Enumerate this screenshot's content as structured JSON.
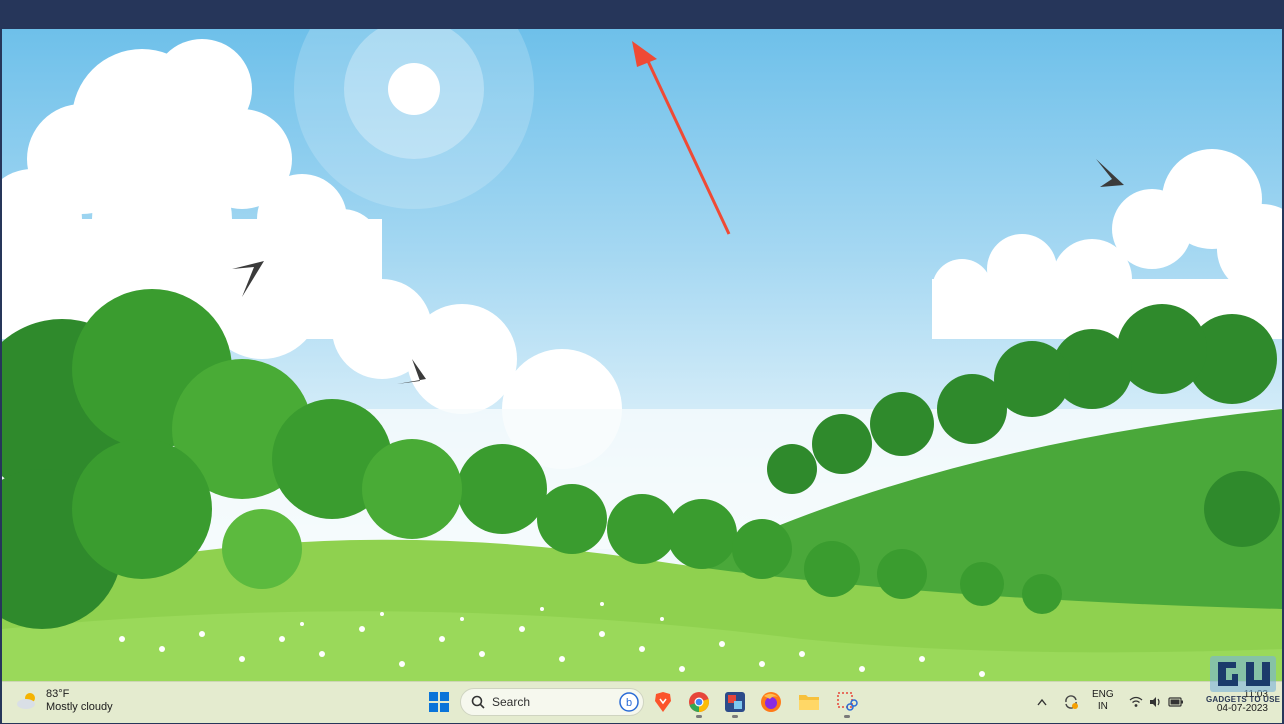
{
  "window": {
    "title_bar_color": "#26365a"
  },
  "wallpaper": {
    "description_colors": {
      "sky": "#6ec0ea",
      "grass": "#8fd14f",
      "trees": "#3a9c2f"
    }
  },
  "annotation": {
    "arrow_color": "#ef4a35"
  },
  "taskbar": {
    "weather": {
      "temp": "83°F",
      "condition": "Mostly cloudy",
      "icon": "partly-cloudy-icon"
    },
    "start_icon": "windows-start-icon",
    "search": {
      "placeholder": "Search",
      "icon": "search-icon",
      "bing_icon": "bing-icon"
    },
    "apps": [
      {
        "name": "brave-icon"
      },
      {
        "name": "chrome-icon"
      },
      {
        "name": "photos-app-icon"
      },
      {
        "name": "firefox-icon"
      },
      {
        "name": "file-explorer-icon"
      },
      {
        "name": "snipping-tool-icon"
      }
    ],
    "tray": {
      "chevron": "chevron-up-icon",
      "lang_line1": "ENG",
      "lang_line2": "IN",
      "wifi": "wifi-icon",
      "volume": "volume-icon",
      "battery": "battery-icon"
    },
    "clock": {
      "time": "11:03",
      "date": "04-07-2023"
    }
  },
  "watermark": {
    "text": "GADGETS TO USE"
  }
}
